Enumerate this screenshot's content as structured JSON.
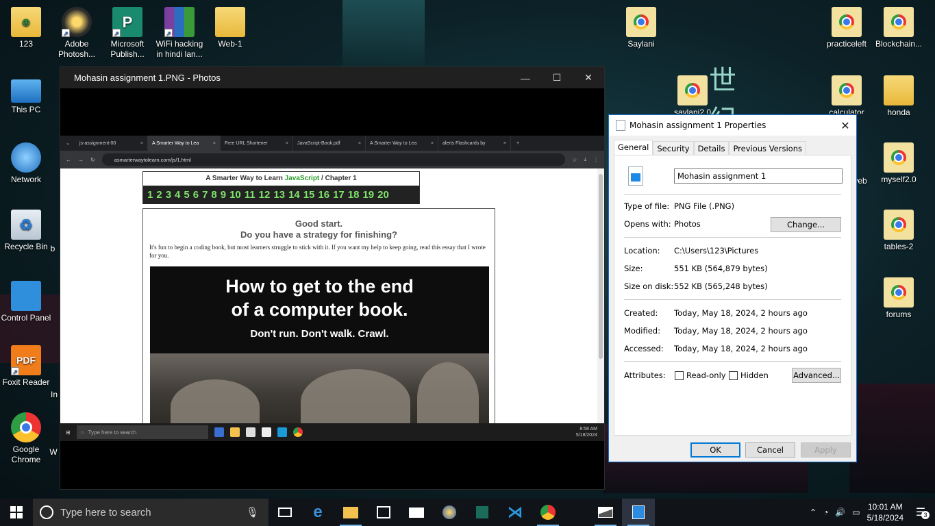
{
  "desktop": {
    "icons_left": [
      {
        "label": "123",
        "icon": "user-folder-icon"
      },
      {
        "label": "Adobe Photosh...",
        "icon": "photoshop-icon"
      },
      {
        "label": "Microsoft Publish...",
        "icon": "publisher-icon"
      },
      {
        "label": "WiFi hacking in hindi lan...",
        "icon": "winrar-icon"
      },
      {
        "label": "Web-1",
        "icon": "folder-icon"
      },
      {
        "label": "This PC",
        "icon": "computer-icon"
      },
      {
        "label": "Network",
        "icon": "network-icon"
      },
      {
        "label": "Recycle Bin",
        "icon": "recycle-bin-icon"
      },
      {
        "label": "Control Panel",
        "icon": "control-panel-icon"
      },
      {
        "label": "Foxit Reader",
        "icon": "pdf-icon"
      },
      {
        "label": "Google Chrome",
        "icon": "chrome-icon"
      }
    ],
    "icons_right": [
      {
        "label": "Saylani",
        "icon": "chrome-html-icon"
      },
      {
        "label": "practiceleft",
        "icon": "chrome-html-icon"
      },
      {
        "label": "Blockchain...",
        "icon": "chrome-html-icon"
      },
      {
        "label": "saylani2.0",
        "icon": "chrome-html-icon"
      },
      {
        "label": "calculator",
        "icon": "chrome-html-icon"
      },
      {
        "label": "honda",
        "icon": "chrome-html-icon"
      },
      {
        "label": "veb",
        "icon": "chrome-html-icon"
      },
      {
        "label": "myself2.0",
        "icon": "chrome-html-icon"
      },
      {
        "label": "tables-2",
        "icon": "chrome-html-icon"
      },
      {
        "label": "forums",
        "icon": "chrome-html-icon"
      }
    ],
    "partial_labels": [
      "b",
      "In",
      "W"
    ]
  },
  "photos_window": {
    "title": "Mohasin assignment 1.PNG - Photos",
    "screenshot": {
      "tabs": [
        {
          "label": "js-assignment-00",
          "active": false
        },
        {
          "label": "A Smarter Way to Lea",
          "active": true
        },
        {
          "label": "Free URL Shortener",
          "active": false
        },
        {
          "label": "JavaScript-Book.pdf",
          "active": false
        },
        {
          "label": "A Smarter Way to Lea",
          "active": false
        },
        {
          "label": "alerts Flashcards by",
          "active": false
        }
      ],
      "url": "asmarterwaytolearn.com/js/1.html",
      "chapter_header_prefix": "A Smarter Way to Learn",
      "chapter_header_js": "JavaScript",
      "chapter_header_suffix": "/  Chapter 1",
      "chapters": [
        "1",
        "2",
        "3",
        "4",
        "5",
        "6",
        "7",
        "8",
        "9",
        "10",
        "11",
        "12",
        "13",
        "14",
        "15",
        "16",
        "17",
        "18",
        "19",
        "20"
      ],
      "heading1": "Good start.",
      "heading2": "Do you have a strategy for finishing?",
      "paragraph": "It's fun to begin a coding book, but most learners struggle to stick with it. If you want my help to keep going, read this essay that I wrote for you.",
      "banner_line1": "How to get to the end",
      "banner_line2": "of a computer book.",
      "banner_sub": "Don't run. Don't walk. Crawl.",
      "mini_search_placeholder": "Type here to search",
      "mini_time": "8:58 AM",
      "mini_date": "5/18/2024"
    }
  },
  "properties_dialog": {
    "title": "Mohasin assignment 1 Properties",
    "tabs": [
      "General",
      "Security",
      "Details",
      "Previous Versions"
    ],
    "active_tab": "General",
    "file_name": "Mohasin assignment 1",
    "rows": {
      "type_label": "Type of file:",
      "type_value": "PNG File (.PNG)",
      "opens_label": "Opens with:",
      "opens_value": "Photos",
      "location_label": "Location:",
      "location_value": "C:\\Users\\123\\Pictures",
      "size_label": "Size:",
      "size_value": "551 KB (564,879 bytes)",
      "disk_label": "Size on disk:",
      "disk_value": "552 KB (565,248 bytes)",
      "created_label": "Created:",
      "created_value": "Today, May 18, 2024, 2 hours ago",
      "modified_label": "Modified:",
      "modified_value": "Today, May 18, 2024, 2 hours ago",
      "accessed_label": "Accessed:",
      "accessed_value": "Today, May 18, 2024, 2 hours ago",
      "attributes_label": "Attributes:"
    },
    "change_button": "Change...",
    "readonly_label": "Read-only",
    "hidden_label": "Hidden",
    "advanced_button": "Advanced...",
    "ok_button": "OK",
    "cancel_button": "Cancel",
    "apply_button": "Apply"
  },
  "taskbar": {
    "search_placeholder": "Type here to search",
    "time": "10:01 AM",
    "date": "5/18/2024",
    "notification_count": "3",
    "apps": [
      "task-view-icon",
      "edge-icon",
      "file-explorer-icon",
      "store-icon",
      "mail-icon",
      "media-icon",
      "app-icon",
      "vscode-icon",
      "chrome-icon",
      "photos-icon",
      "image-viewer-icon"
    ]
  },
  "colors": {
    "accent": "#0078d7",
    "chapter_green": "#7ee36a",
    "js_green": "#2b9e2b",
    "taskbar": "#101418"
  }
}
